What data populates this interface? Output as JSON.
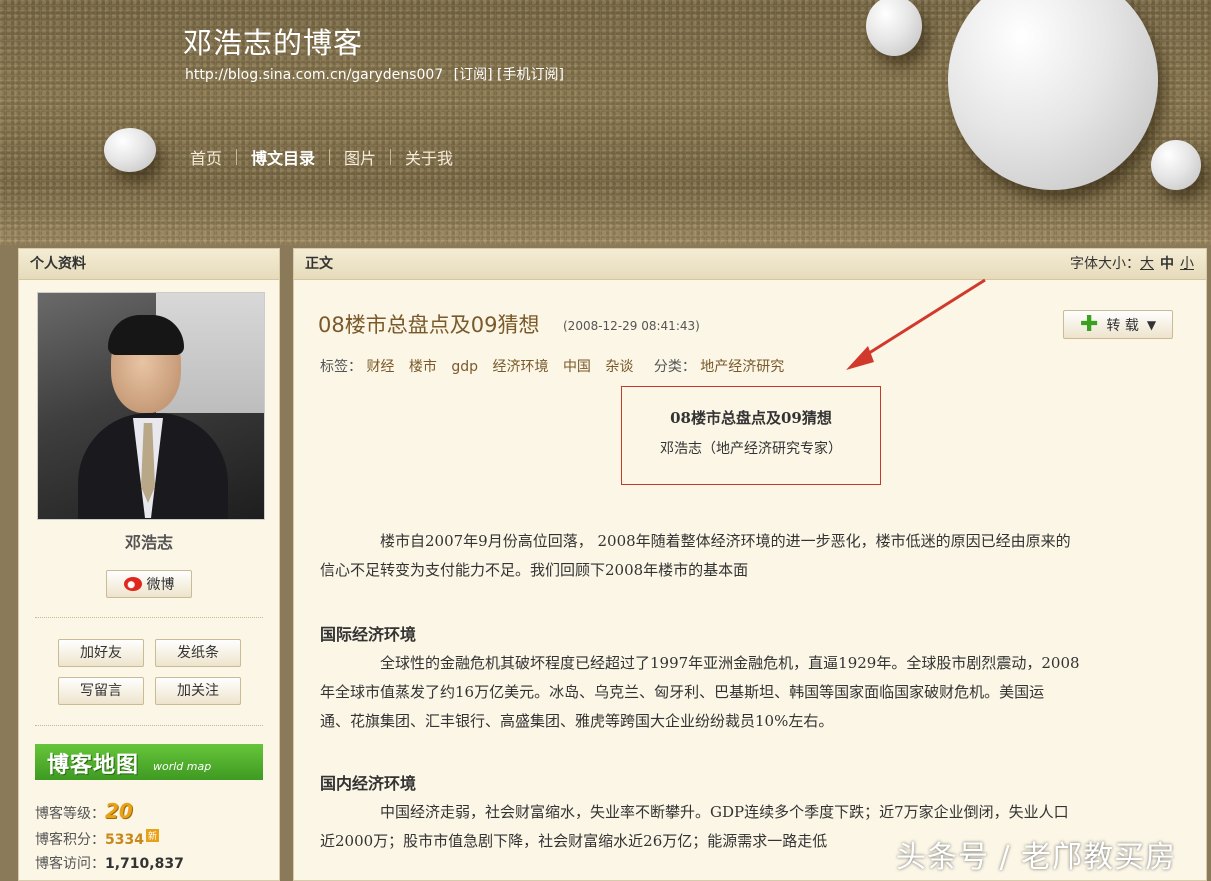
{
  "header": {
    "blog_title": "邓浩志的博客",
    "blog_url": "http://blog.sina.com.cn/garydens007",
    "subscribe": "[订阅]",
    "mobile_subscribe": "[手机订阅]",
    "nav": [
      "首页",
      "博文目录",
      "图片",
      "关于我"
    ]
  },
  "sidebar": {
    "heading": "个人资料",
    "name": "邓浩志",
    "weibo_label": "微博",
    "actions": [
      "加好友",
      "发纸条",
      "写留言",
      "加关注"
    ],
    "map_title": "博客地图",
    "map_sub": "world map",
    "level_label": "博客等级：",
    "level_value": "20",
    "score_label": "博客积分：",
    "score_value": "5334",
    "score_badge": "新",
    "visits_label": "博客访问：",
    "visits_value": "1,710,837"
  },
  "main": {
    "heading": "正文",
    "font_size_label": "字体大小：",
    "font_sizes": [
      "大",
      "中",
      "小"
    ],
    "title": "08楼市总盘点及09猜想",
    "time": "(2008-12-29 08:41:43)",
    "repost_label": "转 载",
    "tags_label": "标签：",
    "tags": [
      "财经",
      "楼市",
      "gdp",
      "经济环境",
      "中国",
      "杂谈"
    ],
    "category_label": "分类：",
    "category": "地产经济研究",
    "box_title": "08楼市总盘点及09猜想",
    "box_author": "邓浩志（地产经济研究专家）",
    "intro_line1": "楼市自2007年9月份高位回落，  2008年随着整体经济环境的进一步恶化，楼市低迷的原因已经由原来的",
    "intro_line2": "信心不足转变为支付能力不足。我们回顾下2008年楼市的基本面",
    "section1_title": "国际经济环境",
    "section1_line1": "全球性的金融危机其破坏程度已经超过了1997年亚洲金融危机，直逼1929年。全球股市剧烈震动，2008",
    "section1_line2": "年全球市值蒸发了约16万亿美元。冰岛、乌克兰、匈牙利、巴基斯坦、韩国等国家面临国家破财危机。美国运",
    "section1_line3": "通、花旗集团、汇丰银行、高盛集团、雅虎等跨国大企业纷纷裁员10%左右。",
    "section2_title": "国内经济环境",
    "section2_line1": "中国经济走弱，社会财富缩水，失业率不断攀升。GDP连续多个季度下跌；近7万家企业倒闭，失业人口",
    "section2_line2": "近2000万；股市市值急剧下降，社会财富缩水近26万亿；能源需求一路走低"
  },
  "watermark": "头条号 / 老邝教买房",
  "colors": {
    "title_brown": "#7a5a2a",
    "box_border": "#c0392b",
    "arrow": "#d0392b"
  }
}
